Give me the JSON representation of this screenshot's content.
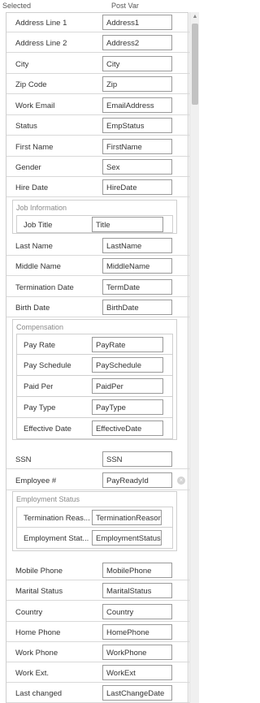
{
  "header": {
    "selected_label": "Selected",
    "postvar_label": "Post Var"
  },
  "rows_top": [
    {
      "label": "Address Line 1",
      "value": "Address1"
    },
    {
      "label": "Address Line 2",
      "value": "Address2"
    },
    {
      "label": "City",
      "value": "City"
    },
    {
      "label": "Zip Code",
      "value": "Zip"
    },
    {
      "label": "Work Email",
      "value": "EmailAddress"
    },
    {
      "label": "Status",
      "value": "EmpStatus"
    },
    {
      "label": "First Name",
      "value": "FirstName"
    },
    {
      "label": "Gender",
      "value": "Sex"
    },
    {
      "label": "Hire Date",
      "value": "HireDate"
    }
  ],
  "job_information": {
    "title": "Job Information",
    "rows": [
      {
        "label": "Job Title",
        "value": "Title"
      }
    ]
  },
  "rows_mid": [
    {
      "label": "Last Name",
      "value": "LastName"
    },
    {
      "label": "Middle Name",
      "value": "MiddleName"
    },
    {
      "label": "Termination Date",
      "value": "TermDate"
    },
    {
      "label": "Birth Date",
      "value": "BirthDate"
    }
  ],
  "compensation": {
    "title": "Compensation",
    "rows": [
      {
        "label": "Pay Rate",
        "value": "PayRate"
      },
      {
        "label": "Pay Schedule",
        "value": "PaySchedule"
      },
      {
        "label": "Paid Per",
        "value": "PaidPer"
      },
      {
        "label": "Pay Type",
        "value": "PayType"
      },
      {
        "label": "Effective Date",
        "value": "EffectiveDate"
      }
    ]
  },
  "rows_after_comp": [
    {
      "label": "SSN",
      "value": "SSN"
    },
    {
      "label": "Employee #",
      "value": "PayReadyId"
    }
  ],
  "employment_status": {
    "title": "Employment Status",
    "rows": [
      {
        "label": "Termination Reas...",
        "value": "TerminationReason"
      },
      {
        "label": "Employment Stat...",
        "value": "EmploymentStatus"
      }
    ]
  },
  "rows_bottom": [
    {
      "label": "Mobile Phone",
      "value": "MobilePhone"
    },
    {
      "label": "Marital Status",
      "value": "MaritalStatus"
    },
    {
      "label": "Country",
      "value": "Country"
    },
    {
      "label": "Home Phone",
      "value": "HomePhone"
    },
    {
      "label": "Work Phone",
      "value": "WorkPhone"
    },
    {
      "label": "Work Ext.",
      "value": "WorkExt"
    },
    {
      "label": "Last changed",
      "value": "LastChangeDate"
    }
  ],
  "icons": {
    "clear": "clear-icon",
    "scroll_up": "scroll-up-arrow-icon"
  }
}
